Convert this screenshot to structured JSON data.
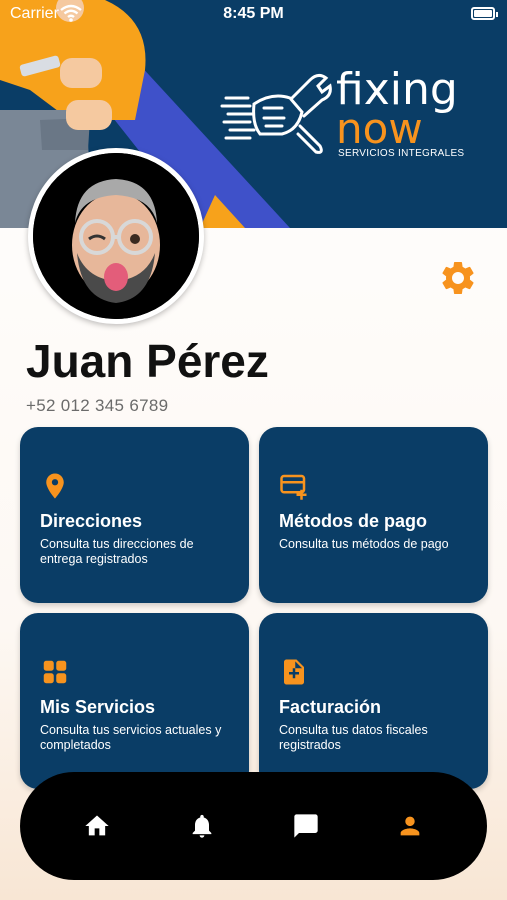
{
  "status_bar": {
    "carrier": "Carrier",
    "time": "8:45 PM"
  },
  "brand": {
    "word1": "fixing",
    "word2": "now",
    "tagline": "SERVICIOS INTEGRALES",
    "colors": {
      "primary": "#0a3d66",
      "accent": "#f7931e"
    }
  },
  "profile": {
    "name": "Juan Pérez",
    "phone": "+52 012 345 6789",
    "settings_icon": "gear-icon"
  },
  "cards": [
    {
      "icon": "location-pin-icon",
      "title": "Direcciones",
      "description": "Consulta tus direcciones de entrega registrados"
    },
    {
      "icon": "credit-card-add-icon",
      "title": "Métodos de pago",
      "description": "Consulta tus métodos de pago"
    },
    {
      "icon": "grid-icon",
      "title": "Mis Servicios",
      "description": "Consulta tus servicios actuales y completados"
    },
    {
      "icon": "document-add-icon",
      "title": "Facturación",
      "description": "Consulta tus datos fiscales registrados"
    }
  ],
  "bottom_nav": {
    "items": [
      {
        "icon": "home-icon",
        "active": false
      },
      {
        "icon": "bell-icon",
        "active": false
      },
      {
        "icon": "chat-icon",
        "active": false
      },
      {
        "icon": "person-icon",
        "active": true
      }
    ],
    "active_color": "#f7931e",
    "inactive_color": "#ffffff"
  }
}
